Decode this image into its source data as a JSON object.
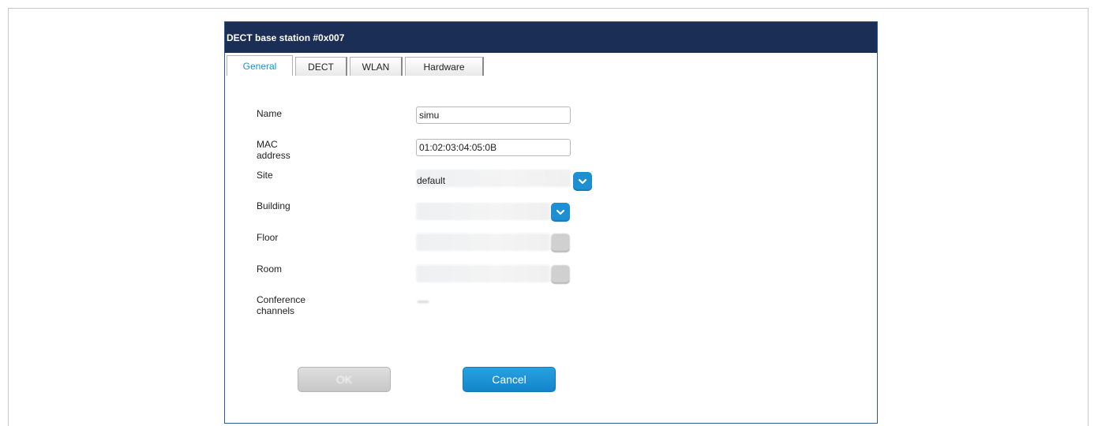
{
  "dialog": {
    "title": "DECT base station #0x007"
  },
  "tabs": [
    {
      "label": "General"
    },
    {
      "label": "DECT"
    },
    {
      "label": "WLAN"
    },
    {
      "label": "Hardware"
    }
  ],
  "form": {
    "name": {
      "label": "Name",
      "value": "simu"
    },
    "mac": {
      "label": "MAC address",
      "value": "01:02:03:04:05:0B"
    },
    "site": {
      "label": "Site",
      "value": "default"
    },
    "building": {
      "label": "Building",
      "value": ""
    },
    "floor": {
      "label": "Floor",
      "value": ""
    },
    "room": {
      "label": "Room",
      "value": ""
    },
    "conference": {
      "label": "Conference channels",
      "value": ""
    }
  },
  "buttons": {
    "ok": "OK",
    "cancel": "Cancel"
  },
  "colors": {
    "titlebar": "#1b2e55",
    "accent": "#1e8fd2",
    "disabled": "#d0d0d0"
  },
  "icons": {
    "dropdown": "chevron-down-icon"
  }
}
